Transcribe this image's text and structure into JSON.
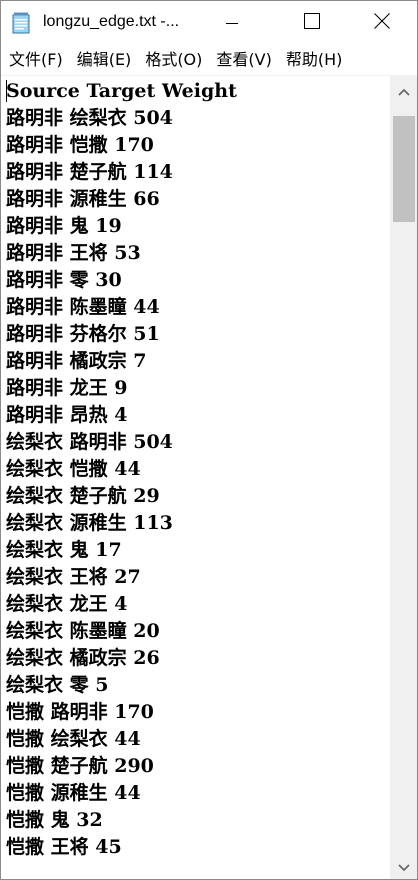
{
  "window": {
    "title": "longzu_edge.txt -...",
    "icon": "notepad-document-icon",
    "controls": {
      "minimize": "minimize-icon",
      "maximize": "maximize-icon",
      "close": "close-icon"
    }
  },
  "menu": [
    {
      "label": "文件(F)"
    },
    {
      "label": "编辑(E)"
    },
    {
      "label": "格式(O)"
    },
    {
      "label": "查看(V)"
    },
    {
      "label": "帮助(H)"
    }
  ],
  "editor": {
    "lines": [
      "Source Target Weight",
      "路明非 绘梨衣 504",
      "路明非 恺撒 170",
      "路明非 楚子航 114",
      "路明非 源稚生 66",
      "路明非 鬼 19",
      "路明非 王将 53",
      "路明非 零 30",
      "路明非 陈墨瞳 44",
      "路明非 芬格尔 51",
      "路明非 橘政宗 7",
      "路明非 龙王 9",
      "路明非 昂热 4",
      "绘梨衣 路明非 504",
      "绘梨衣 恺撒 44",
      "绘梨衣 楚子航 29",
      "绘梨衣 源稚生 113",
      "绘梨衣 鬼 17",
      "绘梨衣 王将 27",
      "绘梨衣 龙王 4",
      "绘梨衣 陈墨瞳 20",
      "绘梨衣 橘政宗 26",
      "绘梨衣 零 5",
      "恺撒 路明非 170",
      "恺撒 绘梨衣 44",
      "恺撒 楚子航 290",
      "恺撒 源稚生 44",
      "恺撒 鬼 32",
      "恺撒 王将 45"
    ]
  },
  "scrollbar": {
    "up": "chevron-up-icon",
    "down": "chevron-down-icon",
    "position": 0.0
  }
}
